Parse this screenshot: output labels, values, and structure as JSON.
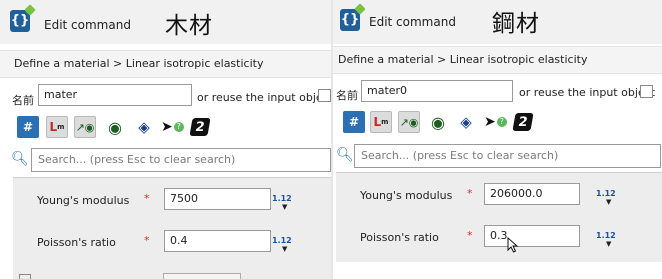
{
  "left": {
    "header_title": "Edit command",
    "header_cjk": "木材",
    "section_path": "Define a material > Linear isotropic elasticity",
    "name_label": "名前",
    "name_value": "mater",
    "reuse_label": "or reuse the input object",
    "search_placeholder": "Search... (press Esc to clear search)",
    "properties": [
      {
        "label": "Young's modulus",
        "required": "*",
        "value": "7500",
        "version": "1.12"
      },
      {
        "label": "Poisson's ratio",
        "required": "*",
        "value": "0.4",
        "version": "1.12"
      }
    ]
  },
  "right": {
    "header_title": "Edit command",
    "header_cjk": "鋼材",
    "section_path": "Define a material > Linear isotropic elasticity",
    "name_label": "名前",
    "name_value": "mater0",
    "reuse_label": "or reuse the input object",
    "search_placeholder": "Search... (press Esc to clear search)",
    "properties": [
      {
        "label": "Young's modulus",
        "required": "*",
        "value": "206000.0",
        "version": "1.12"
      },
      {
        "label": "Poisson's ratio",
        "required": "*",
        "value": "0.3",
        "version": "1.12"
      }
    ]
  },
  "icons": {
    "app": "edit-command-app-icon",
    "toolbar": [
      "hash-icon",
      "axes-icon",
      "axes-eye-icon",
      "eye-icon",
      "cube-icon",
      "pointer-help-icon",
      "number-2-icon"
    ],
    "search": "search-icon"
  },
  "colors": {
    "app_icon": "#1f5f9a",
    "required_star": "#d32f2f",
    "version_badge": "#1f4f9a",
    "props_background": "#ededed"
  }
}
